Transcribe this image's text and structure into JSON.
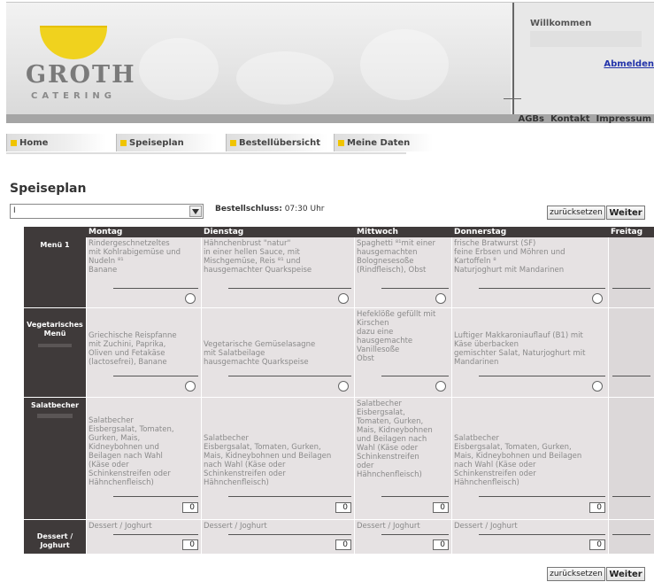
{
  "header": {
    "logo_main": "GROTH",
    "logo_sub": "CATERING",
    "welcome": "Willkommen",
    "logout": "Abmelden"
  },
  "footer_links": [
    "AGBs",
    "Kontakt",
    "Impressum"
  ],
  "tabs": [
    "Home",
    "Speiseplan",
    "Bestellübersicht",
    "Meine Daten"
  ],
  "page": {
    "title": "Speiseplan",
    "select_value": "I",
    "deadline_label": "Bestellschluss:",
    "deadline_value": "07:30 Uhr",
    "reset_label": "zurücksetzen",
    "next_label": "Weiter"
  },
  "days": [
    "Montag",
    "Dienstag",
    "Mittwoch",
    "Donnerstag",
    "Freitag"
  ],
  "rows": [
    {
      "label": "Menü 1",
      "control": "radio",
      "cells": [
        "Rindergeschnetzeltes\nmit Kohlrabigemüse und\nNudeln ⁸¹\nBanane",
        "Hähnchenbrust \"natur\"\nin einer hellen Sauce, mit\nMischgemüse, Reis ⁸¹ und\nhausgemachter Quarkspeise",
        "Spaghetti ⁸¹mit einer\nhausgemachten\nBolognesesoße\n(Rindfleisch), Obst",
        "frische Bratwurst (SF)\nfeine Erbsen und Möhren und\nKartoffeln ⁸\nNaturjoghurt mit Mandarinen"
      ]
    },
    {
      "label": "Vegetarisches\nMenü",
      "control": "radio",
      "cells": [
        "Griechische Reispfanne\nmit Zuchini, Paprika,\nOliven und Fetakäse\n(lactosefrei), Banane",
        "Vegetarische Gemüselasagne\nmit Salatbeilage\nhausgemachte Quarkspeise",
        "Hefeklöße gefüllt mit\nKirschen\ndazu eine\nhausgemachte\nVanillesoße\nObst",
        "Luftiger Makkaroniauflauf (B1) mit\nKäse überbacken\ngemischter Salat, Naturjoghurt mit\nMandarinen"
      ]
    },
    {
      "label": "Salatbecher",
      "control": "qty",
      "qty": "0",
      "cells": [
        "Salatbecher\nEisbergsalat, Tomaten,\nGurken, Mais,\nKidneybohnen und\nBeilagen nach Wahl\n(Käse oder\nSchinkenstreifen oder\nHähnchenfleisch)",
        "Salatbecher\nEisbergsalat, Tomaten, Gurken,\nMais, Kidneybohnen und Beilagen\nnach Wahl (Käse oder\nSchinkenstreifen oder\nHähnchenfleisch)",
        "Salatbecher\nEisbergsalat,\nTomaten, Gurken,\nMais, Kidneybohnen\nund Beilagen nach\nWahl (Käse oder\nSchinkenstreifen\noder\nHähnchenfleisch)",
        "Salatbecher\nEisbergsalat, Tomaten, Gurken,\nMais, Kidneybohnen und Beilagen\nnach Wahl (Käse oder\nSchinkenstreifen oder\nHähnchenfleisch)"
      ]
    },
    {
      "label": "Dessert /\nJoghurt",
      "control": "qty",
      "qty": "0",
      "cells": [
        "Dessert / Joghurt",
        "Dessert / Joghurt",
        "Dessert / Joghurt",
        "Dessert / Joghurt"
      ]
    }
  ],
  "colors": {
    "header_dark": "#3f3a3a",
    "cell_bg": "#e6e2e3",
    "tab_marker": "#f0c400",
    "logo_yellow": "#f0d21e",
    "link": "#2233aa"
  }
}
